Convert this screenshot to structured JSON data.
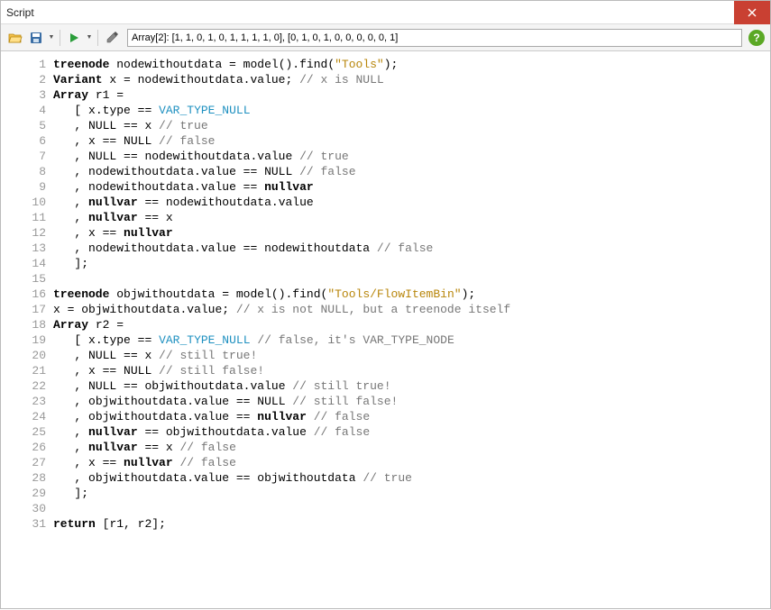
{
  "window": {
    "title": "Script"
  },
  "toolbar": {
    "result_text": "Array[2]: [1, 1, 0, 1, 0, 1, 1, 1, 1, 0], [0, 1, 0, 1, 0, 0, 0, 0, 0, 1]"
  },
  "icons": {
    "open": "open-icon",
    "save": "save-icon",
    "run": "run-icon",
    "sampler": "sampler-icon",
    "help": "?"
  },
  "code_lines": [
    {
      "n": 1,
      "tokens": [
        [
          "type",
          "treenode"
        ],
        [
          "id",
          " nodewithoutdata "
        ],
        [
          "op",
          "="
        ],
        [
          "id",
          " "
        ],
        [
          "fn",
          "model"
        ],
        [
          "op",
          "()."
        ],
        [
          "fn",
          "find"
        ],
        [
          "op",
          "("
        ],
        [
          "str",
          "\"Tools\""
        ],
        [
          "op",
          ");"
        ]
      ]
    },
    {
      "n": 2,
      "tokens": [
        [
          "type",
          "Variant"
        ],
        [
          "id",
          " x "
        ],
        [
          "op",
          "="
        ],
        [
          "id",
          " nodewithoutdata"
        ],
        [
          "op",
          "."
        ],
        [
          "id",
          "value"
        ],
        [
          "op",
          ";"
        ],
        [
          "cm",
          " // x is NULL"
        ]
      ]
    },
    {
      "n": 3,
      "tokens": [
        [
          "type",
          "Array"
        ],
        [
          "id",
          " r1 "
        ],
        [
          "op",
          "="
        ]
      ]
    },
    {
      "n": 4,
      "tokens": [
        [
          "id",
          "   "
        ],
        [
          "op",
          "["
        ],
        [
          "id",
          " x"
        ],
        [
          "op",
          "."
        ],
        [
          "id",
          "type "
        ],
        [
          "op",
          "=="
        ],
        [
          "id",
          " "
        ],
        [
          "const",
          "VAR_TYPE_NULL"
        ]
      ]
    },
    {
      "n": 5,
      "tokens": [
        [
          "id",
          "   "
        ],
        [
          "op",
          ","
        ],
        [
          "id",
          " NULL "
        ],
        [
          "op",
          "=="
        ],
        [
          "id",
          " x "
        ],
        [
          "cm",
          "// true"
        ]
      ]
    },
    {
      "n": 6,
      "tokens": [
        [
          "id",
          "   "
        ],
        [
          "op",
          ","
        ],
        [
          "id",
          " x "
        ],
        [
          "op",
          "=="
        ],
        [
          "id",
          " NULL "
        ],
        [
          "cm",
          "// false"
        ]
      ]
    },
    {
      "n": 7,
      "tokens": [
        [
          "id",
          "   "
        ],
        [
          "op",
          ","
        ],
        [
          "id",
          " NULL "
        ],
        [
          "op",
          "=="
        ],
        [
          "id",
          " nodewithoutdata"
        ],
        [
          "op",
          "."
        ],
        [
          "id",
          "value "
        ],
        [
          "cm",
          "// true"
        ]
      ]
    },
    {
      "n": 8,
      "tokens": [
        [
          "id",
          "   "
        ],
        [
          "op",
          ","
        ],
        [
          "id",
          " nodewithoutdata"
        ],
        [
          "op",
          "."
        ],
        [
          "id",
          "value "
        ],
        [
          "op",
          "=="
        ],
        [
          "id",
          " NULL "
        ],
        [
          "cm",
          "// false"
        ]
      ]
    },
    {
      "n": 9,
      "tokens": [
        [
          "id",
          "   "
        ],
        [
          "op",
          ","
        ],
        [
          "id",
          " nodewithoutdata"
        ],
        [
          "op",
          "."
        ],
        [
          "id",
          "value "
        ],
        [
          "op",
          "=="
        ],
        [
          "id",
          " "
        ],
        [
          "kw",
          "nullvar"
        ]
      ]
    },
    {
      "n": 10,
      "tokens": [
        [
          "id",
          "   "
        ],
        [
          "op",
          ","
        ],
        [
          "id",
          " "
        ],
        [
          "kw",
          "nullvar"
        ],
        [
          "id",
          " "
        ],
        [
          "op",
          "=="
        ],
        [
          "id",
          " nodewithoutdata"
        ],
        [
          "op",
          "."
        ],
        [
          "id",
          "value"
        ]
      ]
    },
    {
      "n": 11,
      "tokens": [
        [
          "id",
          "   "
        ],
        [
          "op",
          ","
        ],
        [
          "id",
          " "
        ],
        [
          "kw",
          "nullvar"
        ],
        [
          "id",
          " "
        ],
        [
          "op",
          "=="
        ],
        [
          "id",
          " x"
        ]
      ]
    },
    {
      "n": 12,
      "tokens": [
        [
          "id",
          "   "
        ],
        [
          "op",
          ","
        ],
        [
          "id",
          " x "
        ],
        [
          "op",
          "=="
        ],
        [
          "id",
          " "
        ],
        [
          "kw",
          "nullvar"
        ]
      ]
    },
    {
      "n": 13,
      "tokens": [
        [
          "id",
          "   "
        ],
        [
          "op",
          ","
        ],
        [
          "id",
          " nodewithoutdata"
        ],
        [
          "op",
          "."
        ],
        [
          "id",
          "value "
        ],
        [
          "op",
          "=="
        ],
        [
          "id",
          " nodewithoutdata "
        ],
        [
          "cm",
          "// false"
        ]
      ]
    },
    {
      "n": 14,
      "tokens": [
        [
          "id",
          "   "
        ],
        [
          "op",
          "];"
        ]
      ]
    },
    {
      "n": 15,
      "tokens": []
    },
    {
      "n": 16,
      "tokens": [
        [
          "type",
          "treenode"
        ],
        [
          "id",
          " objwithoutdata "
        ],
        [
          "op",
          "="
        ],
        [
          "id",
          " "
        ],
        [
          "fn",
          "model"
        ],
        [
          "op",
          "()."
        ],
        [
          "fn",
          "find"
        ],
        [
          "op",
          "("
        ],
        [
          "str",
          "\"Tools/FlowItemBin\""
        ],
        [
          "op",
          ");"
        ]
      ]
    },
    {
      "n": 17,
      "tokens": [
        [
          "id",
          "x "
        ],
        [
          "op",
          "="
        ],
        [
          "id",
          " objwithoutdata"
        ],
        [
          "op",
          "."
        ],
        [
          "id",
          "value"
        ],
        [
          "op",
          ";"
        ],
        [
          "cm",
          " // x is not NULL, but a treenode itself"
        ]
      ]
    },
    {
      "n": 18,
      "tokens": [
        [
          "type",
          "Array"
        ],
        [
          "id",
          " r2 "
        ],
        [
          "op",
          "="
        ]
      ]
    },
    {
      "n": 19,
      "tokens": [
        [
          "id",
          "   "
        ],
        [
          "op",
          "["
        ],
        [
          "id",
          " x"
        ],
        [
          "op",
          "."
        ],
        [
          "id",
          "type "
        ],
        [
          "op",
          "=="
        ],
        [
          "id",
          " "
        ],
        [
          "const",
          "VAR_TYPE_NULL"
        ],
        [
          "id",
          " "
        ],
        [
          "cm",
          "// false, it's VAR_TYPE_NODE"
        ]
      ]
    },
    {
      "n": 20,
      "tokens": [
        [
          "id",
          "   "
        ],
        [
          "op",
          ","
        ],
        [
          "id",
          " NULL "
        ],
        [
          "op",
          "=="
        ],
        [
          "id",
          " x "
        ],
        [
          "cm",
          "// still true!"
        ]
      ]
    },
    {
      "n": 21,
      "tokens": [
        [
          "id",
          "   "
        ],
        [
          "op",
          ","
        ],
        [
          "id",
          " x "
        ],
        [
          "op",
          "=="
        ],
        [
          "id",
          " NULL "
        ],
        [
          "cm",
          "// still false!"
        ]
      ]
    },
    {
      "n": 22,
      "tokens": [
        [
          "id",
          "   "
        ],
        [
          "op",
          ","
        ],
        [
          "id",
          " NULL "
        ],
        [
          "op",
          "=="
        ],
        [
          "id",
          " objwithoutdata"
        ],
        [
          "op",
          "."
        ],
        [
          "id",
          "value "
        ],
        [
          "cm",
          "// still true!"
        ]
      ]
    },
    {
      "n": 23,
      "tokens": [
        [
          "id",
          "   "
        ],
        [
          "op",
          ","
        ],
        [
          "id",
          " objwithoutdata"
        ],
        [
          "op",
          "."
        ],
        [
          "id",
          "value "
        ],
        [
          "op",
          "=="
        ],
        [
          "id",
          " NULL "
        ],
        [
          "cm",
          "// still false!"
        ]
      ]
    },
    {
      "n": 24,
      "tokens": [
        [
          "id",
          "   "
        ],
        [
          "op",
          ","
        ],
        [
          "id",
          " objwithoutdata"
        ],
        [
          "op",
          "."
        ],
        [
          "id",
          "value "
        ],
        [
          "op",
          "=="
        ],
        [
          "id",
          " "
        ],
        [
          "kw",
          "nullvar"
        ],
        [
          "id",
          " "
        ],
        [
          "cm",
          "// false"
        ]
      ]
    },
    {
      "n": 25,
      "tokens": [
        [
          "id",
          "   "
        ],
        [
          "op",
          ","
        ],
        [
          "id",
          " "
        ],
        [
          "kw",
          "nullvar"
        ],
        [
          "id",
          " "
        ],
        [
          "op",
          "=="
        ],
        [
          "id",
          " objwithoutdata"
        ],
        [
          "op",
          "."
        ],
        [
          "id",
          "value "
        ],
        [
          "cm",
          "// false"
        ]
      ]
    },
    {
      "n": 26,
      "tokens": [
        [
          "id",
          "   "
        ],
        [
          "op",
          ","
        ],
        [
          "id",
          " "
        ],
        [
          "kw",
          "nullvar"
        ],
        [
          "id",
          " "
        ],
        [
          "op",
          "=="
        ],
        [
          "id",
          " x "
        ],
        [
          "cm",
          "// false"
        ]
      ]
    },
    {
      "n": 27,
      "tokens": [
        [
          "id",
          "   "
        ],
        [
          "op",
          ","
        ],
        [
          "id",
          " x "
        ],
        [
          "op",
          "=="
        ],
        [
          "id",
          " "
        ],
        [
          "kw",
          "nullvar"
        ],
        [
          "id",
          " "
        ],
        [
          "cm",
          "// false"
        ]
      ]
    },
    {
      "n": 28,
      "tokens": [
        [
          "id",
          "   "
        ],
        [
          "op",
          ","
        ],
        [
          "id",
          " objwithoutdata"
        ],
        [
          "op",
          "."
        ],
        [
          "id",
          "value "
        ],
        [
          "op",
          "=="
        ],
        [
          "id",
          " objwithoutdata "
        ],
        [
          "cm",
          "// true"
        ]
      ]
    },
    {
      "n": 29,
      "tokens": [
        [
          "id",
          "   "
        ],
        [
          "op",
          "];"
        ]
      ]
    },
    {
      "n": 30,
      "tokens": []
    },
    {
      "n": 31,
      "tokens": [
        [
          "kw",
          "return"
        ],
        [
          "id",
          " "
        ],
        [
          "op",
          "["
        ],
        [
          "id",
          "r1"
        ],
        [
          "op",
          ","
        ],
        [
          "id",
          " r2"
        ],
        [
          "op",
          "];"
        ]
      ]
    }
  ]
}
